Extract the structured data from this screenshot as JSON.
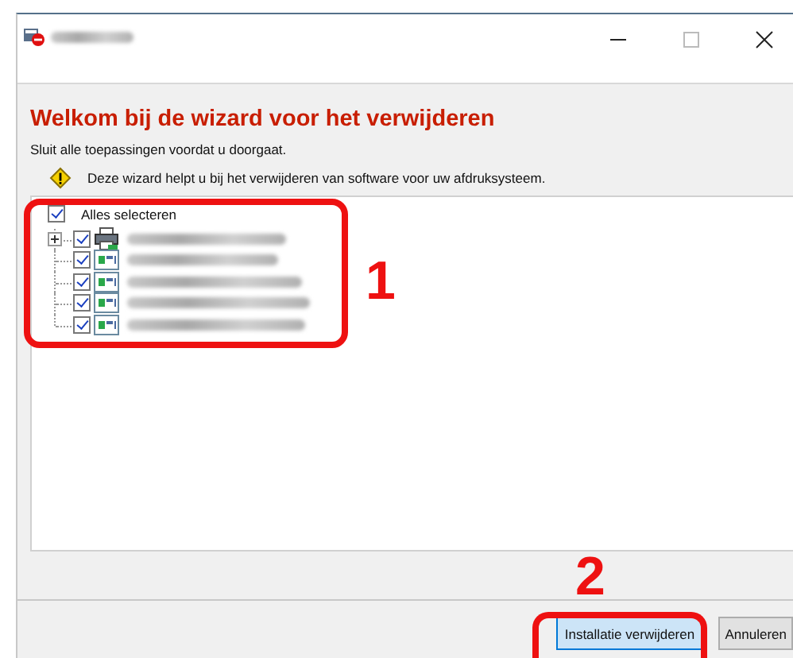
{
  "heading": "Welkom bij de wizard voor het verwijderen",
  "subtitle": "Sluit alle toepassingen voordat u doorgaat.",
  "notice": "Deze wizard helpt u bij het verwijderen van software voor uw afdruksysteem.",
  "select_all": {
    "label": "Alles selecteren",
    "checked": true
  },
  "items": [
    {
      "kind": "printer",
      "checked": true
    },
    {
      "kind": "component",
      "checked": true
    },
    {
      "kind": "component",
      "checked": true
    },
    {
      "kind": "component",
      "checked": true
    },
    {
      "kind": "component",
      "checked": true
    }
  ],
  "buttons": [
    {
      "label": "Installatie verwijderen",
      "kind": "primary"
    },
    {
      "label": "Annuleren",
      "kind": "secondary"
    }
  ],
  "callouts": [
    "1",
    "2"
  ]
}
